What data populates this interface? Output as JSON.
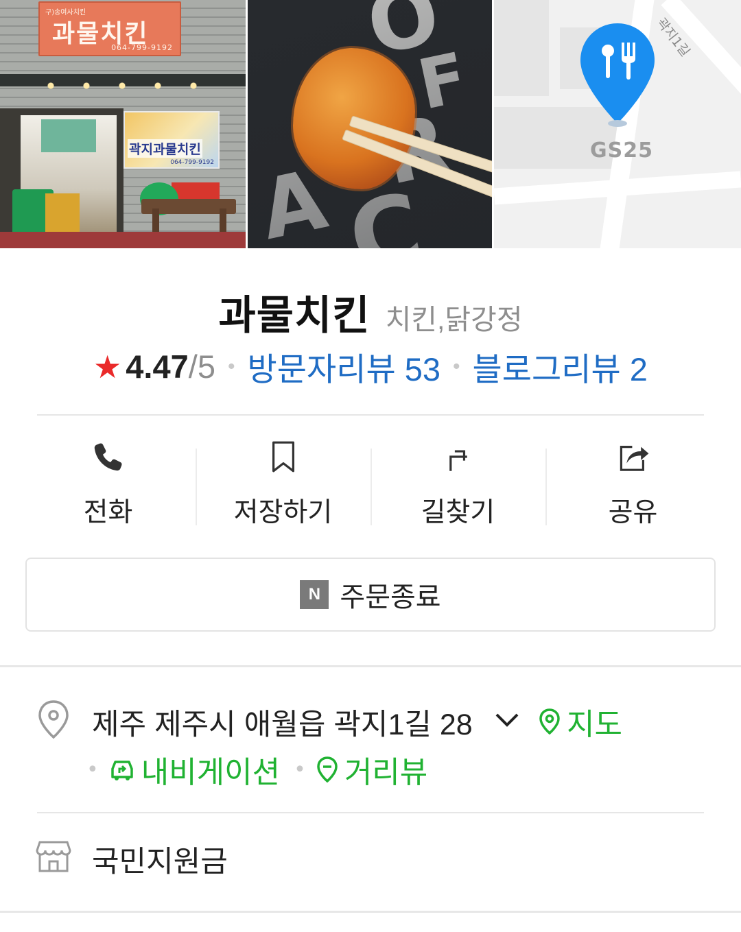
{
  "photos": {
    "storefront": {
      "sign_small": "구)송여사치킨",
      "sign_name": "과물치킨",
      "sign_tel": "064-799-9192",
      "poster_name": "곽지과물치킨",
      "poster_tel": "064-799-9192"
    },
    "map": {
      "road_label": "곽지1길",
      "poi_label": "GS25"
    }
  },
  "place": {
    "name": "과물치킨",
    "category": "치킨,닭강정"
  },
  "rating": {
    "value": "4.47",
    "max": "/5",
    "visitor_reviews": "방문자리뷰 53",
    "blog_reviews": "블로그리뷰 2"
  },
  "actions": [
    {
      "label": "전화",
      "icon": "phone-icon"
    },
    {
      "label": "저장하기",
      "icon": "bookmark-icon"
    },
    {
      "label": "길찾기",
      "icon": "directions-icon"
    },
    {
      "label": "공유",
      "icon": "share-icon"
    }
  ],
  "order": {
    "badge": "N",
    "label": "주문종료"
  },
  "address": {
    "text": "제주 제주시 애월읍 곽지1길 28",
    "map_link": "지도",
    "navigation_link": "내비게이션",
    "street_view_link": "거리뷰"
  },
  "support": {
    "text": "국민지원금"
  },
  "colors": {
    "link_blue": "#1f6cc4",
    "link_green": "#20b232",
    "star_red": "#ea2a2a",
    "map_pin": "#1a8ef0"
  }
}
